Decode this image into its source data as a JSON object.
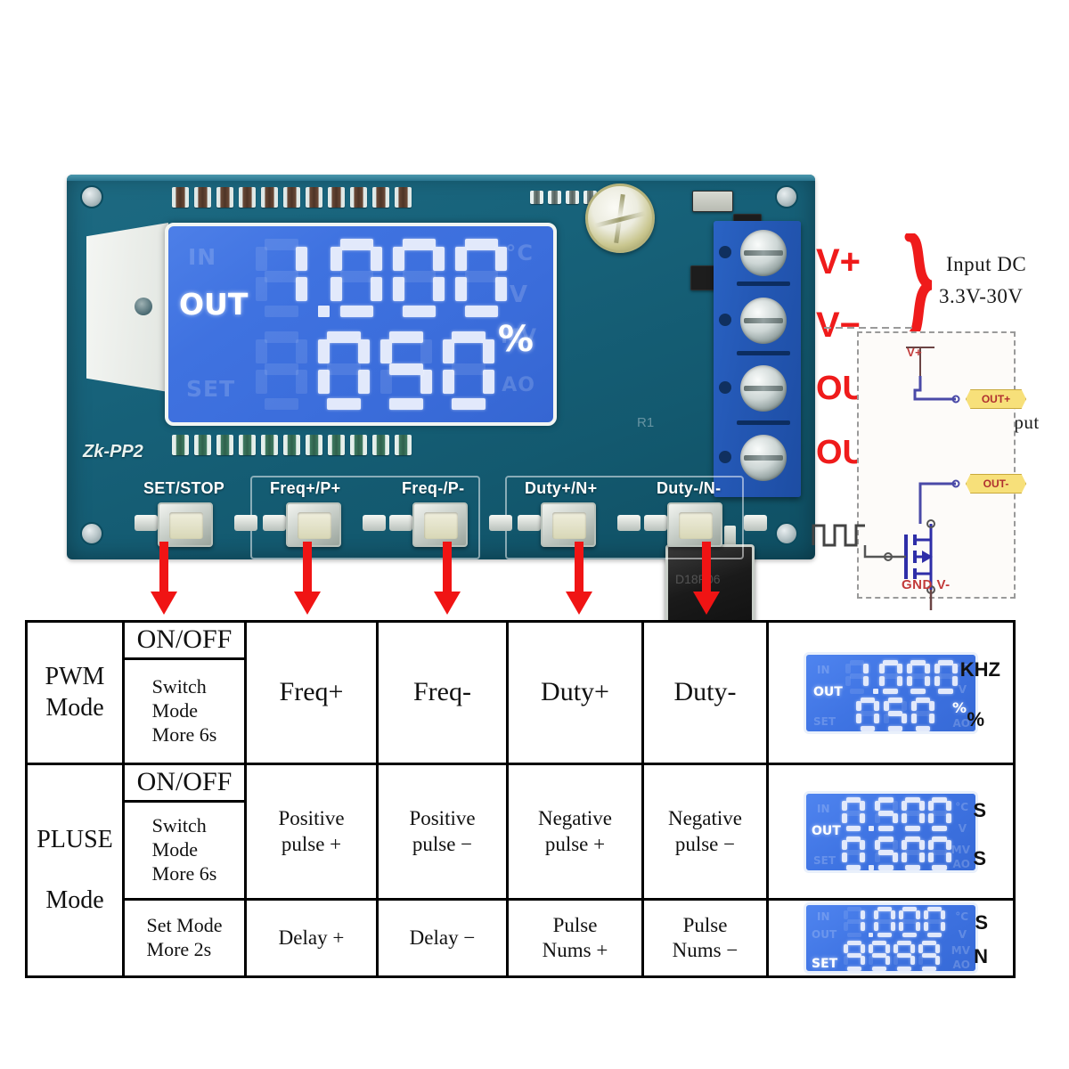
{
  "board": {
    "silkscreen_model": "Zk-PP2",
    "silkscreen_r1": "R1",
    "mosfet_text": "D18P06",
    "buttons": [
      {
        "label": "SET/STOP"
      },
      {
        "label": "Freq+/P+"
      },
      {
        "label": "Freq-/P-"
      },
      {
        "label": "Duty+/N+"
      },
      {
        "label": "Duty-/N-"
      }
    ],
    "lcd": {
      "ghost_in": "IN",
      "lit_out": "OUT",
      "ghost_set": "SET",
      "ghost_degc": "°C",
      "ghost_v": "V",
      "ghost_mv": "MV",
      "ghost_ao": "AO",
      "line1_value": "1.000",
      "line2_value": "050",
      "line2_unit": "%"
    }
  },
  "wiring": {
    "v_plus": "V+",
    "v_minus": "V−",
    "out_plus": "OUT+",
    "out_minus": "OUT−",
    "input_dc_line1": "Input DC",
    "input_dc_line2": "3.3V-30V",
    "signal_output": "Singnal Output",
    "schematic": {
      "v_plus_node": "V+",
      "out_plus_tag": "OUT+",
      "out_minus_tag": "OUT-",
      "gnd_label": "GND V-"
    }
  },
  "table": {
    "rows": [
      {
        "mode": "PWM\nMode",
        "mode_line1": "PWM",
        "mode_line2": "Mode",
        "setstop_top": "ON/OFF",
        "setstop_bottom": "Switch\nMode\nMore 6s",
        "setstop_bottom_l1": "Switch",
        "setstop_bottom_l2": "Mode",
        "setstop_bottom_l3": "More 6s",
        "freq_plus": "Freq+",
        "freq_minus": "Freq-",
        "duty_plus": "Duty+",
        "duty_minus": "Duty-",
        "display": {
          "row_label": "OUT",
          "line1": "1.000",
          "line2": "050",
          "line2_unit": "%",
          "unit_top": "KHZ",
          "unit_bottom": "%"
        }
      },
      {
        "mode_line1": "PLUSE",
        "mode_line2": "Mode",
        "setstop_top": "ON/OFF",
        "setstop_bottom_l1": "Switch",
        "setstop_bottom_l2": "Mode",
        "setstop_bottom_l3": "More 6s",
        "freq_plus_l1": "Positive",
        "freq_plus_l2": "pulse +",
        "freq_minus_l1": "Positive",
        "freq_minus_l2": "pulse −",
        "duty_plus_l1": "Negative",
        "duty_plus_l2": "pulse +",
        "duty_minus_l1": "Negative",
        "duty_minus_l2": "pulse −",
        "display": {
          "row_label": "OUT",
          "line1": "0.500",
          "line2": "0.500",
          "unit_top": "S",
          "unit_bottom": "S"
        }
      },
      {
        "setstop_l1": "Set Mode",
        "setstop_l2": "More 2s",
        "freq_plus": "Delay +",
        "freq_minus": "Delay −",
        "duty_plus_l1": "Pulse",
        "duty_plus_l2": "Nums +",
        "duty_minus_l1": "Pulse",
        "duty_minus_l2": "Nums −",
        "display": {
          "row_label": "SET",
          "line1": "1.000",
          "line2": "9999",
          "unit_top": "S",
          "unit_bottom": "N"
        }
      }
    ]
  },
  "colors": {
    "arrow_red": "#f01414",
    "label_red": "#ef1b1b",
    "pcb_teal": "#17627a",
    "lcd_blue": "#3f72e0",
    "terminal_blue": "#2458b5",
    "yellow_tag": "#f7e07a"
  }
}
